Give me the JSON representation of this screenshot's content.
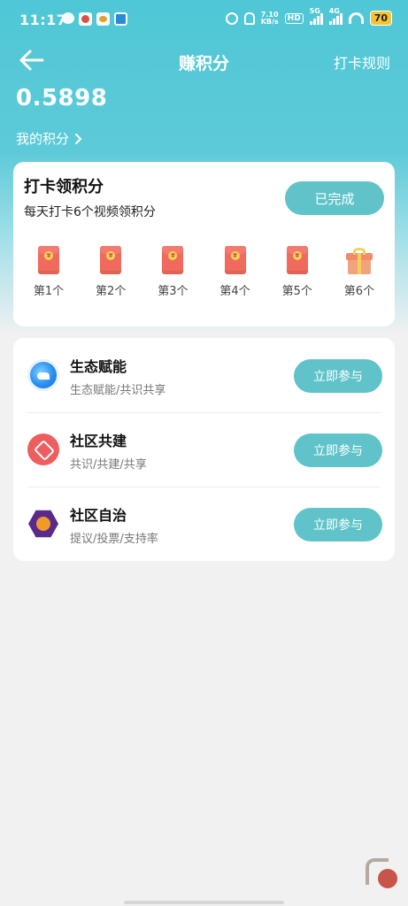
{
  "status_bar": {
    "time": "11:17",
    "speed": "7.10\nKB/s",
    "hd": "HD",
    "signal_1": "5G",
    "signal_2": "4G",
    "battery": "70"
  },
  "header": {
    "title": "赚积分",
    "rules_link": "打卡规则"
  },
  "points": {
    "value": "0.5898",
    "my_points_label": "我的积分"
  },
  "checkin": {
    "title": "打卡领积分",
    "subtitle": "每天打卡6个视频领积分",
    "button_label": "已完成",
    "rewards": [
      {
        "label": "第1个",
        "icon": "red-envelope-icon"
      },
      {
        "label": "第2个",
        "icon": "red-envelope-icon"
      },
      {
        "label": "第3个",
        "icon": "red-envelope-icon"
      },
      {
        "label": "第4个",
        "icon": "red-envelope-icon"
      },
      {
        "label": "第5个",
        "icon": "red-envelope-icon"
      },
      {
        "label": "第6个",
        "icon": "gift-box-icon"
      }
    ]
  },
  "tasks": [
    {
      "title": "生态赋能",
      "desc": "生态赋能/共识共享",
      "button": "立即参与",
      "icon": "ecology-icon"
    },
    {
      "title": "社区共建",
      "desc": "共识/共建/共享",
      "button": "立即参与",
      "icon": "community-icon"
    },
    {
      "title": "社区自治",
      "desc": "提议/投票/支持率",
      "button": "立即参与",
      "icon": "governance-icon"
    }
  ],
  "colors": {
    "accent": "#5fc3c9",
    "header_gradient_top": "#4fc7d6",
    "background": "#f1f1f2"
  }
}
